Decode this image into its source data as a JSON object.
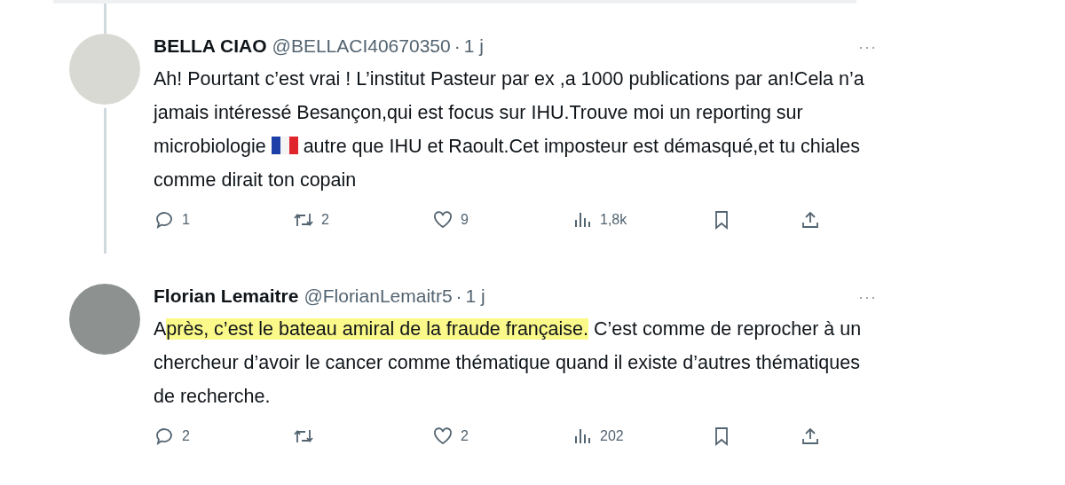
{
  "tweets": [
    {
      "name": "BELLA CIAO",
      "handle": "@BELLACI40670350",
      "separator": "·",
      "time": "1 j",
      "more": "···",
      "body": [
        {
          "kind": "text",
          "text": "Ah! Pourtant c’est vrai ! L’institut Pasteur par ex ,a 1000 publications par an!Cela n’a jamais intéressé Besançon,qui est focus sur IHU.Trouve moi un reporting sur microbiologie ",
          "highlighted": false
        },
        {
          "kind": "flag"
        },
        {
          "kind": "text",
          "text": " autre que IHU et Raoult.Cet imposteur est démasqué,et tu chiales comme dirait ton copain",
          "highlighted": false
        }
      ],
      "actions": [
        {
          "kind": "reply",
          "count": "1"
        },
        {
          "kind": "repost",
          "count": "2"
        },
        {
          "kind": "like",
          "count": "9"
        },
        {
          "kind": "views",
          "count": "1,8k"
        },
        {
          "kind": "bookmark"
        },
        {
          "kind": "share"
        }
      ]
    },
    {
      "name": "Florian Lemaitre",
      "handle": "@FlorianLemaitr5",
      "separator": "·",
      "time": "1 j",
      "more": "···",
      "body": [
        {
          "kind": "text",
          "text": "A",
          "highlighted": false
        },
        {
          "kind": "text",
          "text": "près, c’est le bateau amiral de la fraude française.",
          "highlighted": true
        },
        {
          "kind": "text",
          "text": " C’est comme de reprocher à un chercheur d’avoir le cancer comme thématique quand il existe d’autres thématiques de recherche.",
          "highlighted": false
        }
      ],
      "actions": [
        {
          "kind": "reply",
          "count": "2"
        },
        {
          "kind": "repost"
        },
        {
          "kind": "like",
          "count": "2"
        },
        {
          "kind": "views",
          "count": "202"
        },
        {
          "kind": "bookmark"
        },
        {
          "kind": "share"
        }
      ]
    }
  ]
}
